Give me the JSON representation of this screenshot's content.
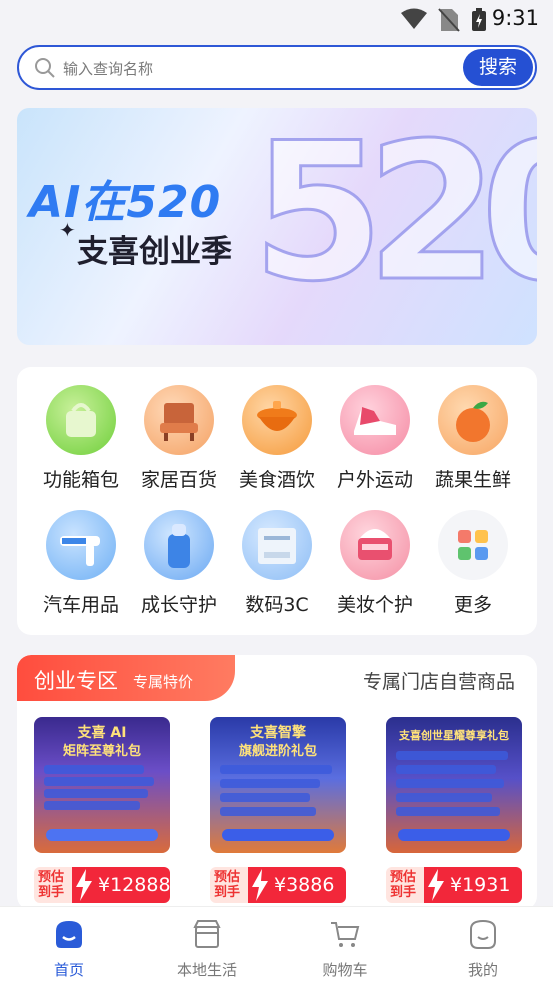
{
  "status": {
    "time": "9:31"
  },
  "search": {
    "placeholder": "输入查询名称",
    "button": "搜索"
  },
  "banner": {
    "line1": "AI在520",
    "line2": "支喜创业季",
    "big": "520"
  },
  "categories": [
    {
      "label": "功能箱包",
      "icon": "bag-icon"
    },
    {
      "label": "家居百货",
      "icon": "sofa-icon"
    },
    {
      "label": "美食酒饮",
      "icon": "food-bowl-icon"
    },
    {
      "label": "户外运动",
      "icon": "sneaker-icon"
    },
    {
      "label": "蔬果生鲜",
      "icon": "peach-icon"
    },
    {
      "label": "汽车用品",
      "icon": "car-brush-icon"
    },
    {
      "label": "成长守护",
      "icon": "baby-bottle-icon"
    },
    {
      "label": "数码3C",
      "icon": "printer-icon"
    },
    {
      "label": "美妆个护",
      "icon": "cream-jar-icon"
    },
    {
      "label": "更多",
      "icon": "more-grid-icon"
    }
  ],
  "startup": {
    "tab_main": "创业专区",
    "tab_sub": "专属特价",
    "tab_other": "专属门店自营商品",
    "products": [
      {
        "title1": "支喜 AI",
        "title2": "矩阵至尊礼包",
        "est": "预估到手",
        "est1": "预估",
        "est2": "到手",
        "price": "¥12888"
      },
      {
        "title1": "支喜智擎",
        "title2": "旗舰进阶礼包",
        "est": "预估到手",
        "est1": "预估",
        "est2": "到手",
        "price": "¥3886"
      },
      {
        "title1": "支喜创世星耀尊享礼包",
        "title2": "",
        "est": "预估到手",
        "est1": "预估",
        "est2": "到手",
        "price": "¥1931"
      }
    ]
  },
  "tabbar": [
    {
      "label": "首页",
      "icon": "home-icon",
      "active": true
    },
    {
      "label": "本地生活",
      "icon": "store-icon",
      "active": false
    },
    {
      "label": "购物车",
      "icon": "cart-icon",
      "active": false
    },
    {
      "label": "我的",
      "icon": "profile-icon",
      "active": false
    }
  ],
  "colors": {
    "accent": "#2550d3",
    "price_red": "#f2273a"
  }
}
